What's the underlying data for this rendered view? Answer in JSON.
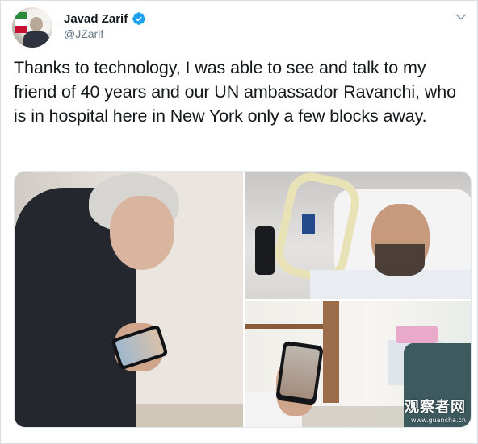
{
  "tweet": {
    "author": {
      "display_name": "Javad Zarif",
      "handle": "@JZarif",
      "verified": true,
      "avatar_icon": "profile-avatar"
    },
    "text": "Thanks to technology, I was able to see and talk to my friend of 40 years and our UN ambassador Ravanchi, who is in hospital here in New York only a few blocks away.",
    "menu_icon": "chevron-down-icon",
    "media": [
      {
        "name": "photo-zarif-video-call",
        "icon": "photo"
      },
      {
        "name": "photo-ravanchi-hospital-bed",
        "icon": "photo"
      },
      {
        "name": "photo-hospital-room-phone",
        "icon": "photo"
      }
    ]
  },
  "watermark": {
    "main": "观察者网",
    "sub": "www.guancha.cn"
  },
  "colors": {
    "verified_blue": "#1da1f2",
    "text_primary": "#14171a",
    "text_secondary": "#657786",
    "border": "#e1e8ed"
  }
}
